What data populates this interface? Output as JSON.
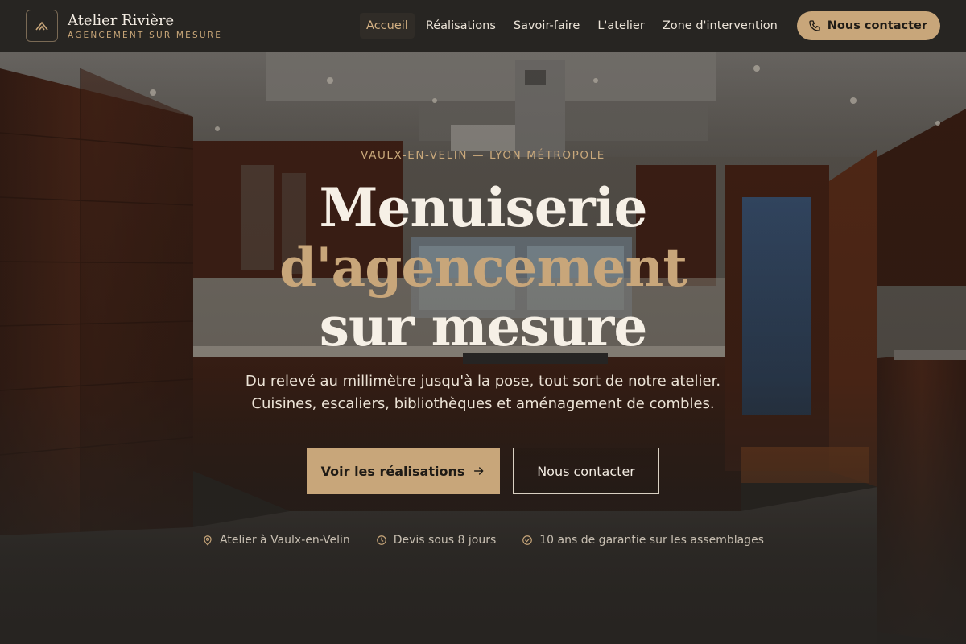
{
  "brand": {
    "name": "Atelier Rivière",
    "tagline": "AGENCEMENT SUR MESURE",
    "logo_icon": "chevron-up-logo"
  },
  "nav": {
    "items": [
      {
        "label": "Accueil",
        "active": true
      },
      {
        "label": "Réalisations",
        "active": false
      },
      {
        "label": "Savoir-faire",
        "active": false
      },
      {
        "label": "L'atelier",
        "active": false
      },
      {
        "label": "Zone d'intervention",
        "active": false
      }
    ],
    "contact_label": "Nous contacter",
    "contact_icon": "phone-icon"
  },
  "hero": {
    "kicker": "VAULX-EN-VELIN — LYON MÉTROPOLE",
    "title_line1": "Menuiserie",
    "title_line2": "d'agencement",
    "title_line3": "sur mesure",
    "subtitle_line1": "Du relevé au millimètre jusqu'à la pose, tout sort de notre atelier.",
    "subtitle_line2": "Cuisines, escaliers, bibliothèques et aménagement de combles.",
    "primary_cta": "Voir les réalisations",
    "secondary_cta": "Nous contacter",
    "facts": [
      {
        "icon": "map-pin-icon",
        "label": "Atelier à Vaulx-en-Velin"
      },
      {
        "icon": "clock-icon",
        "label": "Devis sous 8 jours"
      },
      {
        "icon": "check-circle-icon",
        "label": "10 ans de garantie sur les assemblages"
      }
    ]
  },
  "colors": {
    "accent": "#c8a67a",
    "header_bg": "#272522",
    "text_light": "#f3ece2"
  }
}
